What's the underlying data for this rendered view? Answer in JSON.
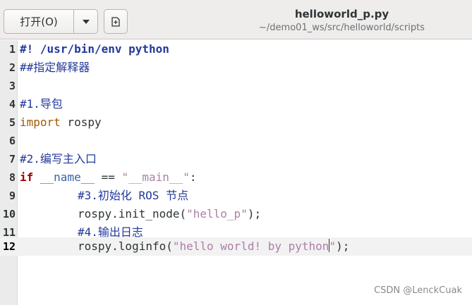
{
  "header": {
    "open_button_label": "打开(O)",
    "dropdown_icon": "chevron-down-icon",
    "new_tab_icon": "new-document-icon",
    "file_title": "helloworld_p.py",
    "file_path": "~/demo01_ws/src/helloworld/scripts"
  },
  "editor": {
    "current_line": "12",
    "lines": [
      {
        "n": "1",
        "t": [
          "#! /usr/bin/env python"
        ]
      },
      {
        "n": "2",
        "t": [
          "##指定解释器"
        ]
      },
      {
        "n": "3",
        "t": []
      },
      {
        "n": "4",
        "t": [
          "#1.导包"
        ]
      },
      {
        "n": "5",
        "t": [
          "import",
          " rospy"
        ]
      },
      {
        "n": "6",
        "t": []
      },
      {
        "n": "7",
        "t": [
          "#2.编写主入口"
        ]
      },
      {
        "n": "8",
        "t": [
          "if",
          " ",
          "__name__",
          " == ",
          "\"__main__\"",
          ":"
        ]
      },
      {
        "n": "9",
        "t": [
          "#3.初始化 ROS 节点"
        ]
      },
      {
        "n": "10",
        "t": [
          "rospy.init_node(",
          "\"hello_p\"",
          ");"
        ]
      },
      {
        "n": "11",
        "t": [
          "#4.输出日志"
        ]
      },
      {
        "n": "12",
        "t": [
          "rospy.loginfo(",
          "\"hello world! by python",
          "\"",
          ");"
        ]
      }
    ]
  },
  "watermark": "CSDN @LenckCuak",
  "colors": {
    "comment": "#23399a",
    "keyword_import": "#a05a00",
    "keyword_if": "#a40000",
    "dunder_name": "#3465a4",
    "string": "#ad7fa8",
    "header_bg": "#efedec",
    "gutter_bg": "#ebebeb"
  }
}
